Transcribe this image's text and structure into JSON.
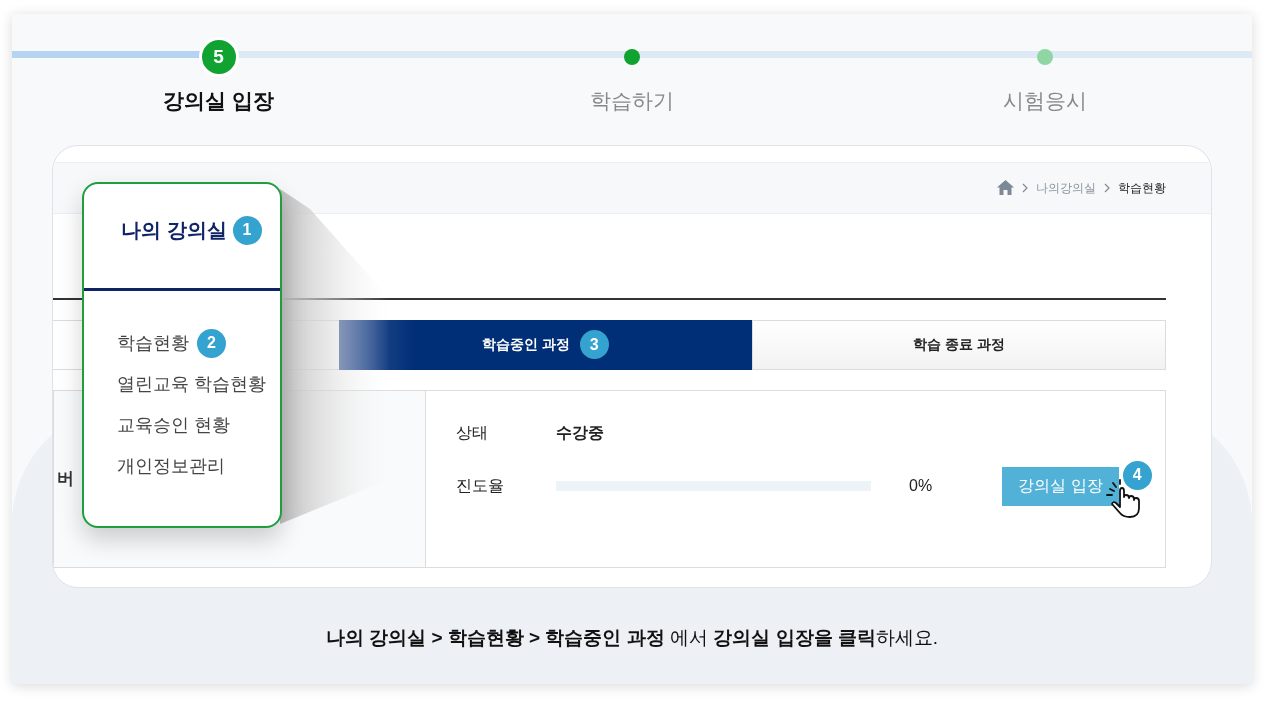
{
  "steps": [
    {
      "label": "강의실 입장",
      "kind": "current",
      "badge": "5"
    },
    {
      "label": "학습하기",
      "kind": "next"
    },
    {
      "label": "시험응시",
      "kind": "upcoming"
    }
  ],
  "breadcrumb": [
    "나의강의실",
    "학습현황"
  ],
  "menu": {
    "title": "나의 강의실",
    "badge": "1",
    "items": [
      {
        "label": "학습현황",
        "badge": "2"
      },
      {
        "label": "열린교육 학습현황"
      },
      {
        "label": "교육승인 현황"
      },
      {
        "label": "개인정보관리"
      }
    ]
  },
  "tabs": [
    {
      "label": "학습중인 과정",
      "selected": true,
      "badge": "3"
    },
    {
      "label": "학습 종료 과정",
      "selected": false
    }
  ],
  "course": {
    "title_fragment": "버",
    "status_label": "상태",
    "status_value": "수강중",
    "progress_label": "진도율",
    "level": 0,
    "progress_text": "0%",
    "enter_button": "강의실 입장",
    "button_badge": "4"
  },
  "instruction": "**나의 강의실 > 학습현황 > 학습중인 과정** 에서 **강의실 입장을 클릭**하세요."
}
